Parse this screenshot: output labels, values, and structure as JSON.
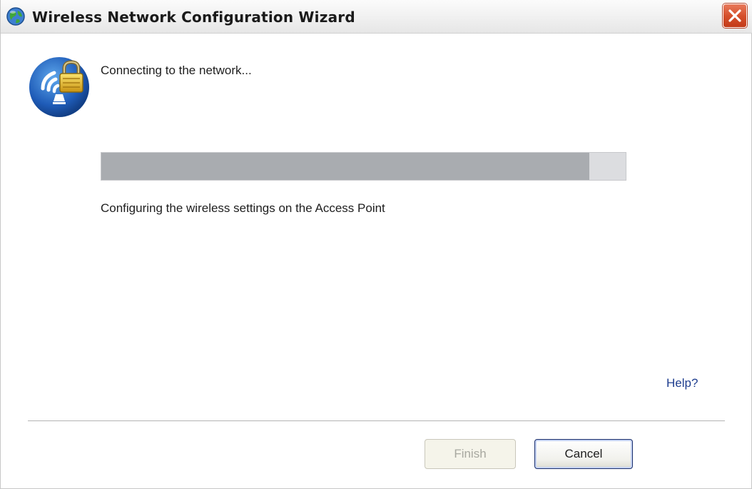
{
  "window": {
    "title": "Wireless Network Configuration Wizard"
  },
  "content": {
    "heading": "Connecting to the network...",
    "status": "Configuring the wireless settings on the Access Point",
    "progress_percent": 93,
    "help_link": "Help?"
  },
  "buttons": {
    "finish_label": "Finish",
    "cancel_label": "Cancel",
    "finish_enabled": false
  },
  "icons": {
    "title": "globe-icon",
    "close": "close-icon",
    "wizard": "wireless-lock-icon"
  },
  "colors": {
    "close_button": "#d6502c",
    "progress_fill": "#a9acb0",
    "progress_track": "#dcdde0",
    "link": "#1f3e8f"
  }
}
